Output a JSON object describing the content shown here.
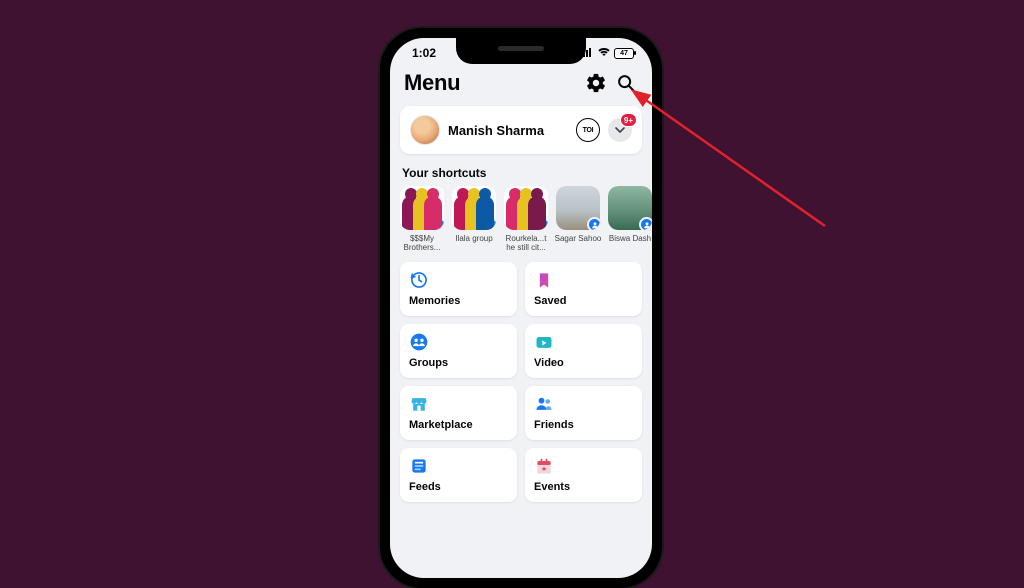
{
  "status": {
    "time": "1:02",
    "battery": "47"
  },
  "header": {
    "title": "Menu"
  },
  "profile": {
    "name": "Manish Sharma",
    "coin_label": "TOI",
    "badge": "9+"
  },
  "shortcuts": {
    "title": "Your shortcuts",
    "items": [
      {
        "label": "$$$My Brothers..."
      },
      {
        "label": "Ilala group"
      },
      {
        "label": "Rourkela...t he still cit..."
      },
      {
        "label": "Sagar Sahoo"
      },
      {
        "label": "Biswa Dash"
      }
    ]
  },
  "tiles": [
    {
      "key": "memories",
      "label": "Memories"
    },
    {
      "key": "saved",
      "label": "Saved"
    },
    {
      "key": "groups",
      "label": "Groups"
    },
    {
      "key": "video",
      "label": "Video"
    },
    {
      "key": "marketplace",
      "label": "Marketplace"
    },
    {
      "key": "friends",
      "label": "Friends"
    },
    {
      "key": "feeds",
      "label": "Feeds"
    },
    {
      "key": "events",
      "label": "Events"
    }
  ],
  "colors": {
    "fb_blue": "#1877f2",
    "badge_red": "#e41e3f"
  }
}
